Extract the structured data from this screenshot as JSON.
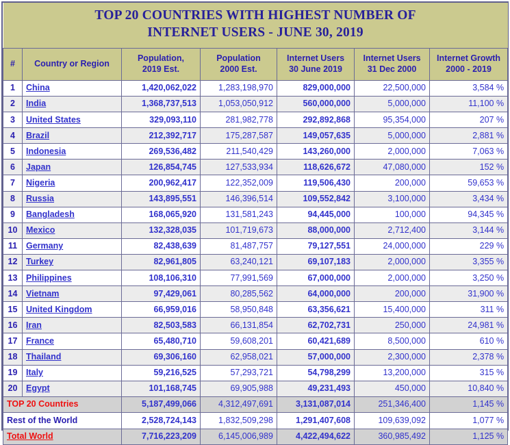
{
  "table": {
    "title_line1": "TOP 20 COUNTRIES WITH HIGHEST NUMBER OF",
    "title_line2": "INTERNET USERS - JUNE 30, 2019",
    "columns": [
      {
        "line1": "#",
        "line2": ""
      },
      {
        "line1": "Country or Region",
        "line2": ""
      },
      {
        "line1": "Population,",
        "line2": "2019 Est."
      },
      {
        "line1": "Population",
        "line2": "2000 Est."
      },
      {
        "line1": "Internet Users",
        "line2": "30 June 2019"
      },
      {
        "line1": "Internet Users",
        "line2": "31 Dec 2000"
      },
      {
        "line1": "Internet Growth",
        "line2": "2000 - 2019"
      }
    ],
    "rows": [
      {
        "rank": "1",
        "country": "China",
        "pop2019": "1,420,062,022",
        "pop2000": "1,283,198,970",
        "users2019": "829,000,000",
        "users2000": "22,500,000",
        "growth": "3,584 %"
      },
      {
        "rank": "2",
        "country": "India",
        "pop2019": "1,368,737,513",
        "pop2000": "1,053,050,912",
        "users2019": "560,000,000",
        "users2000": "5,000,000",
        "growth": "11,100 %"
      },
      {
        "rank": "3",
        "country": "United States",
        "pop2019": "329,093,110",
        "pop2000": "281,982,778",
        "users2019": "292,892,868",
        "users2000": "95,354,000",
        "growth": "207 %"
      },
      {
        "rank": "4",
        "country": "Brazil",
        "pop2019": "212,392,717",
        "pop2000": "175,287,587",
        "users2019": "149,057,635",
        "users2000": "5,000,000",
        "growth": "2,881 %"
      },
      {
        "rank": "5",
        "country": "Indonesia",
        "pop2019": "269,536,482",
        "pop2000": "211,540,429",
        "users2019": "143,260,000",
        "users2000": "2,000,000",
        "growth": "7,063 %"
      },
      {
        "rank": "6",
        "country": "Japan",
        "pop2019": "126,854,745",
        "pop2000": "127,533,934",
        "users2019": "118,626,672",
        "users2000": "47,080,000",
        "growth": "152 %"
      },
      {
        "rank": "7",
        "country": "Nigeria",
        "pop2019": "200,962,417",
        "pop2000": "122,352,009",
        "users2019": "119,506,430",
        "users2000": "200,000",
        "growth": "59,653 %"
      },
      {
        "rank": "8",
        "country": "Russia",
        "pop2019": "143,895,551",
        "pop2000": "146,396,514",
        "users2019": "109,552,842",
        "users2000": "3,100,000",
        "growth": "3,434 %"
      },
      {
        "rank": "9",
        "country": "Bangladesh",
        "pop2019": "168,065,920",
        "pop2000": "131,581,243",
        "users2019": "94,445,000",
        "users2000": "100,000",
        "growth": "94,345 %"
      },
      {
        "rank": "10",
        "country": "Mexico",
        "pop2019": "132,328,035",
        "pop2000": "101,719,673",
        "users2019": "88,000,000",
        "users2000": "2,712,400",
        "growth": "3,144 %"
      },
      {
        "rank": "11",
        "country": "Germany",
        "pop2019": "82,438,639",
        "pop2000": "81,487,757",
        "users2019": "79,127,551",
        "users2000": "24,000,000",
        "growth": "229 %"
      },
      {
        "rank": "12",
        "country": "Turkey",
        "pop2019": "82,961,805",
        "pop2000": "63,240,121",
        "users2019": "69,107,183",
        "users2000": "2,000,000",
        "growth": "3,355 %"
      },
      {
        "rank": "13",
        "country": "Philippines",
        "pop2019": "108,106,310",
        "pop2000": "77,991,569",
        "users2019": "67,000,000",
        "users2000": "2,000,000",
        "growth": "3,250 %"
      },
      {
        "rank": "14",
        "country": "Vietnam",
        "pop2019": "97,429,061",
        "pop2000": "80,285,562",
        "users2019": "64,000,000",
        "users2000": "200,000",
        "growth": "31,900 %"
      },
      {
        "rank": "15",
        "country": "United Kingdom",
        "pop2019": "66,959,016",
        "pop2000": "58,950,848",
        "users2019": "63,356,621",
        "users2000": "15,400,000",
        "growth": "311 %"
      },
      {
        "rank": "16",
        "country": "Iran",
        "pop2019": "82,503,583",
        "pop2000": "66,131,854",
        "users2019": "62,702,731",
        "users2000": "250,000",
        "growth": "24,981 %"
      },
      {
        "rank": "17",
        "country": "France",
        "pop2019": "65,480,710",
        "pop2000": "59,608,201",
        "users2019": "60,421,689",
        "users2000": "8,500,000",
        "growth": "610 %"
      },
      {
        "rank": "18",
        "country": "Thailand",
        "pop2019": "69,306,160",
        "pop2000": "62,958,021",
        "users2019": "57,000,000",
        "users2000": "2,300,000",
        "growth": "2,378 %"
      },
      {
        "rank": "19",
        "country": "Italy",
        "pop2019": "59,216,525",
        "pop2000": "57,293,721",
        "users2019": "54,798,299",
        "users2000": "13,200,000",
        "growth": "315 %"
      },
      {
        "rank": "20",
        "country": "Egypt",
        "pop2019": "101,168,745",
        "pop2000": "69,905,988",
        "users2019": "49,231,493",
        "users2000": "450,000",
        "growth": "10,840 %"
      }
    ],
    "summary_rows": [
      {
        "label": "TOP 20 Countries",
        "pop2019": "5,187,499,066",
        "pop2000": "4,312,497,691",
        "users2019": "3,131,087,014",
        "users2000": "251,346,400",
        "growth": "1,145 %"
      },
      {
        "label": "Rest of the World",
        "pop2019": "2,528,724,143",
        "pop2000": "1,832,509,298",
        "users2019": "1,291,407,608",
        "users2000": "109,639,092",
        "growth": "1,077 %"
      },
      {
        "label": "Total World",
        "pop2019": "7,716,223,209",
        "pop2000": "6,145,006,989",
        "users2019": "4,422,494,622",
        "users2000": "360,985,492",
        "growth": "1,125 %"
      }
    ]
  },
  "colors": {
    "header_background": "#cbca8f",
    "title_text": "#27209a",
    "link_blue": "#3232cc",
    "summary_red": "#ee1111",
    "border": "#6a6a96",
    "row_alt": "#ececec",
    "summary_gray": "#d2d2d2"
  }
}
